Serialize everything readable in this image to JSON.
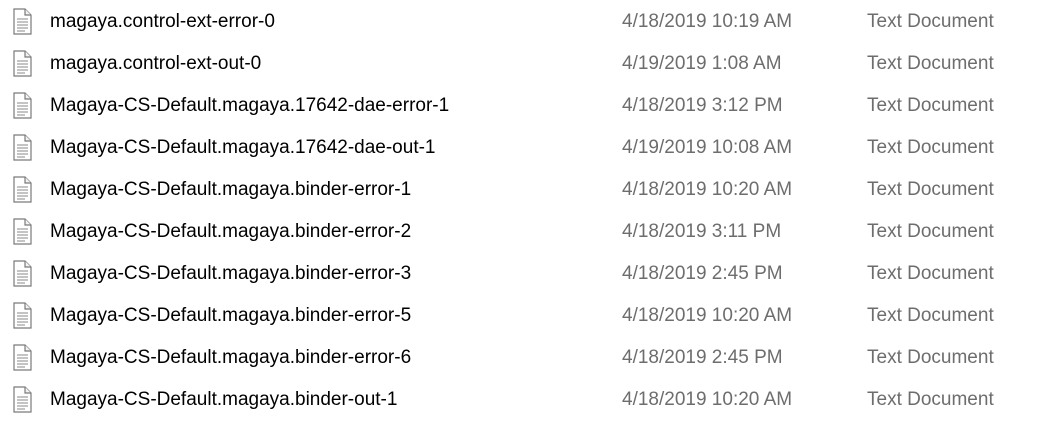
{
  "file_list": {
    "icon": "text-document-icon",
    "rows": [
      {
        "name": "magaya.control-ext-error-0",
        "date_modified": "4/18/2019 10:19 AM",
        "type": "Text Document"
      },
      {
        "name": "magaya.control-ext-out-0",
        "date_modified": "4/19/2019 1:08 AM",
        "type": "Text Document"
      },
      {
        "name": "Magaya-CS-Default.magaya.17642-dae-error-1",
        "date_modified": "4/18/2019 3:12 PM",
        "type": "Text Document"
      },
      {
        "name": "Magaya-CS-Default.magaya.17642-dae-out-1",
        "date_modified": "4/19/2019 10:08 AM",
        "type": "Text Document"
      },
      {
        "name": "Magaya-CS-Default.magaya.binder-error-1",
        "date_modified": "4/18/2019 10:20 AM",
        "type": "Text Document"
      },
      {
        "name": "Magaya-CS-Default.magaya.binder-error-2",
        "date_modified": "4/18/2019 3:11 PM",
        "type": "Text Document"
      },
      {
        "name": "Magaya-CS-Default.magaya.binder-error-3",
        "date_modified": "4/18/2019 2:45 PM",
        "type": "Text Document"
      },
      {
        "name": "Magaya-CS-Default.magaya.binder-error-5",
        "date_modified": "4/18/2019 10:20 AM",
        "type": "Text Document"
      },
      {
        "name": "Magaya-CS-Default.magaya.binder-error-6",
        "date_modified": "4/18/2019 2:45 PM",
        "type": "Text Document"
      },
      {
        "name": "Magaya-CS-Default.magaya.binder-out-1",
        "date_modified": "4/18/2019 10:20 AM",
        "type": "Text Document"
      }
    ]
  }
}
